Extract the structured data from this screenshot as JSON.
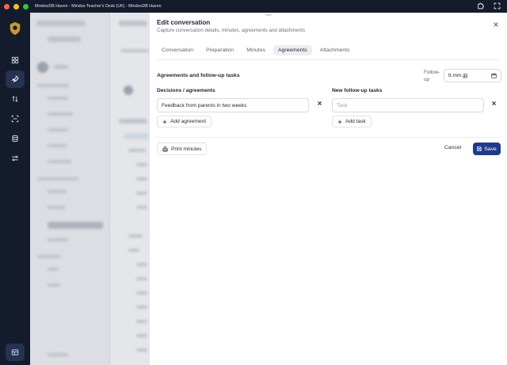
{
  "window": {
    "title": "MindooDB Haven - Mindoo Teacher's Desk (UK) - MindooDB Haven"
  },
  "rail": {
    "items": [
      "dashboard-icon",
      "rocket-icon",
      "sort-icon",
      "scan-icon",
      "database-icon",
      "sliders-icon"
    ],
    "active_index": 1
  },
  "modal": {
    "title": "Edit conversation",
    "subtitle": "Capture conversation details, minutes, agreements and attachments",
    "tabs": [
      {
        "label": "Conversation"
      },
      {
        "label": "Preparation"
      },
      {
        "label": "Minutes"
      },
      {
        "label": "Agreements"
      },
      {
        "label": "Attachments"
      }
    ],
    "active_tab": "Agreements",
    "section_title": "Agreements and follow-up tasks",
    "followup_label": "Follow-up",
    "followup_date_placeholder": "tt.mm.jjjj",
    "decisions": {
      "label": "Decisions / agreements",
      "items": [
        "Feedback from parents in two weeks"
      ],
      "add_label": "Add agreement"
    },
    "tasks": {
      "label": "New follow-up tasks",
      "placeholder": "Task",
      "add_label": "Add task"
    },
    "print_label": "Print minutes",
    "cancel_label": "Cancel",
    "save_label": "Save"
  },
  "colors": {
    "primary": "#1e3a8a",
    "rail_bg": "#141b2d",
    "rail_active": "#253252"
  }
}
